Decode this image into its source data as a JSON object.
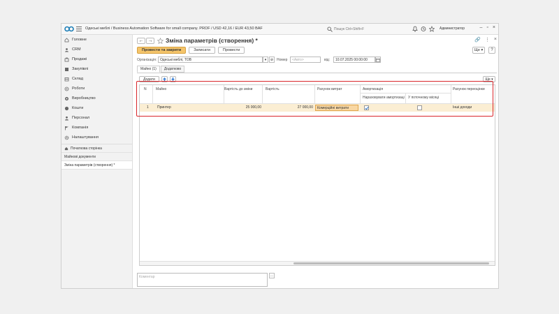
{
  "titlebar": {
    "app_title": "Одеські меблі / Business Automation Software for small company. PROF / USD 42,16 / EUR 43,50 BAF",
    "search_placeholder": "Пошук Ctrl+Shift+F",
    "user": "Администратор"
  },
  "sidebar": {
    "items": [
      {
        "label": "Головне",
        "icon": "home-icon"
      },
      {
        "label": "CRM",
        "icon": "crm-icon"
      },
      {
        "label": "Продажі",
        "icon": "sales-icon"
      },
      {
        "label": "Закупівлі",
        "icon": "purchases-icon"
      },
      {
        "label": "Склад",
        "icon": "warehouse-icon"
      },
      {
        "label": "Роботи",
        "icon": "works-icon"
      },
      {
        "label": "Виробництво",
        "icon": "production-icon"
      },
      {
        "label": "Кошти",
        "icon": "money-icon"
      },
      {
        "label": "Персонал",
        "icon": "staff-icon"
      },
      {
        "label": "Компанія",
        "icon": "company-flag-icon"
      },
      {
        "label": "Налаштування",
        "icon": "settings-gear-icon"
      }
    ],
    "open_windows": [
      {
        "label": "Початкова сторінка"
      },
      {
        "label": "Майнові документи"
      },
      {
        "label": "Зміна параметрів (створення) *"
      }
    ]
  },
  "header": {
    "back": "←",
    "forward": "→",
    "title": "Зміна параметрів (створення) *",
    "right_link": "🔗",
    "right_menu": "⋮",
    "right_close": "×"
  },
  "toolbar": {
    "post_close": "Провести та закрити",
    "save": "Записати",
    "post": "Провести",
    "more": "Ще ▾",
    "help": "?"
  },
  "fields": {
    "org_label": "Організація:",
    "org_value": "Одеські меблі, ТОВ",
    "number_label": "Номер",
    "number_placeholder": "<Авто>",
    "date_label": "від:",
    "date_value": "10.07.2025  00:00:00"
  },
  "tabs": [
    {
      "label": "Майно (1)"
    },
    {
      "label": "Додатково"
    }
  ],
  "table": {
    "add": "Додати",
    "more": "Ще ▾",
    "headers": {
      "n": "N",
      "asset": "Майно",
      "cost_before": "Вартість до зміни",
      "cost": "Вартість",
      "exp_account": "Рахунок витрат",
      "amort": "Амортизація",
      "amort_charge": "Нараховувати амортизацію",
      "current_month": "У поточному місяці",
      "reval_account": "Рахунок переоцінки"
    },
    "rows": [
      {
        "n": "1",
        "asset": "Принтер",
        "cost_before": "25 000,00",
        "cost": "27 000,00",
        "exp_account": "Комерційні витрати",
        "amort_charge": true,
        "current_month": false,
        "reval_account": "Інші доходи"
      }
    ]
  },
  "comment": {
    "placeholder": "Коментар",
    "btn": "..."
  },
  "colors": {
    "primary_button": "#f5c56b",
    "row_highlight": "#fbeed3",
    "frame_red": "#d9262b"
  }
}
